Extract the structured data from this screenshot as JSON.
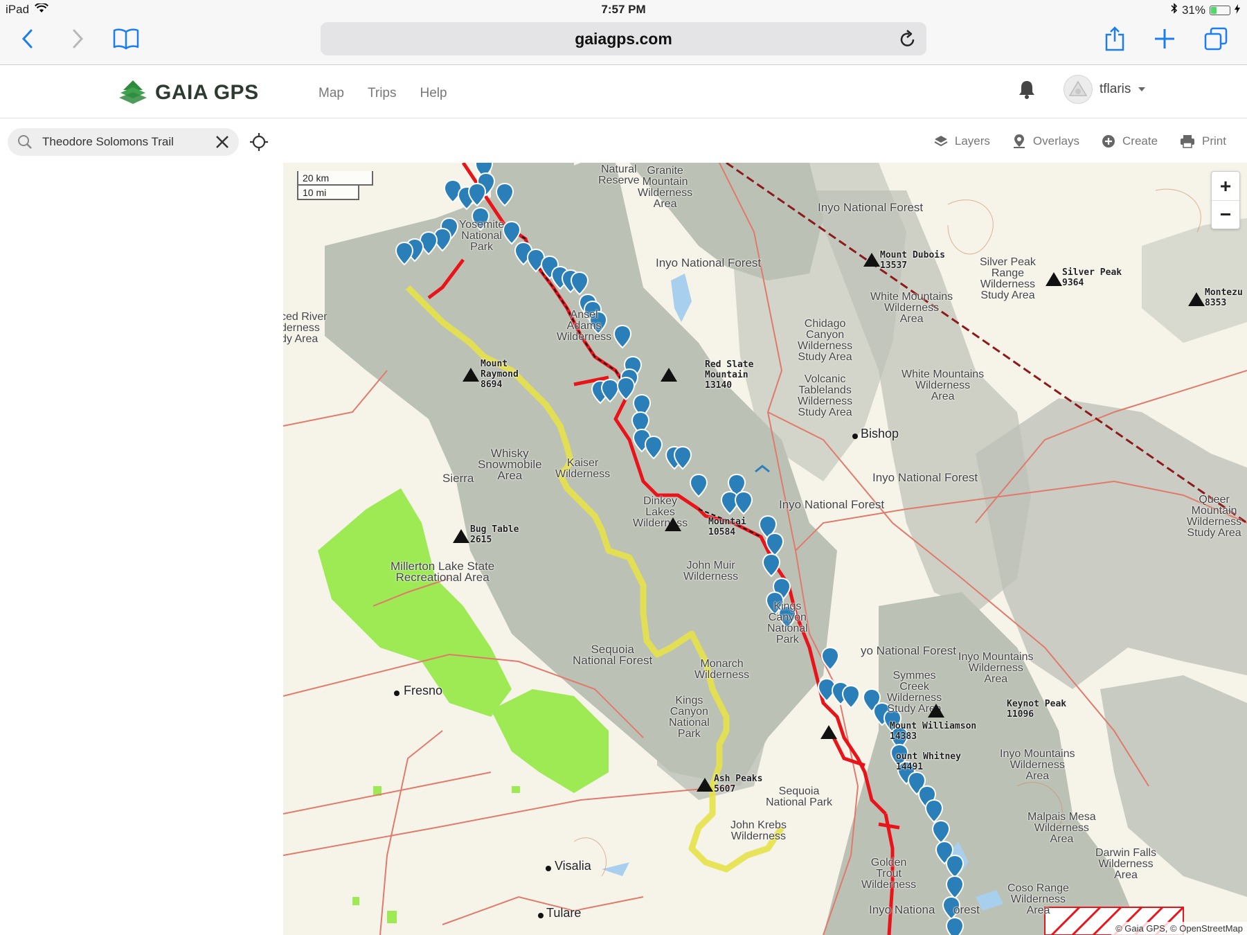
{
  "status_bar": {
    "device": "iPad",
    "time": "7:57 PM",
    "battery": "31%",
    "battery_level": 0.31
  },
  "browser": {
    "url": "gaiagps.com"
  },
  "header": {
    "brand": "GAIA GPS",
    "nav": [
      "Map",
      "Trips",
      "Help"
    ],
    "username": "tflaris"
  },
  "search": {
    "value": "Theodore Solomons Trail"
  },
  "toolbar": {
    "layers": "Layers",
    "overlays": "Overlays",
    "create": "Create",
    "print": "Print"
  },
  "map": {
    "scale": {
      "km": "20 km",
      "mi": "10 mi"
    },
    "zoom_in": "+",
    "zoom_out": "−",
    "attribution": "© Gaia GPS, © OpenStreetMap",
    "colors": {
      "route": "#e8141a",
      "trail": "#e6e24a",
      "waypoint": "#2a7fb8",
      "park": "#9dea54",
      "forest": "#b9beb4"
    },
    "labels": {
      "natural_reserve": "Natural\nReserve",
      "granite_mountain": "Granite\nMountain\nWilderness\nArea",
      "inyo_nf_1": "Inyo National Forest",
      "inyo_nf_2": "Inyo National Forest",
      "inyo_nf_3": "Inyo National Forest",
      "inyo_nf_4": "Inyo National Forest",
      "inyo_nf_5": "yo National Forest",
      "inyo_nf_6": "Inyo Nationa",
      "inyo_nf_7": "orest",
      "yosemite": "Yosemite\nNational\nPark",
      "ansel_adams": "Ansel\nAdams\nWilderness",
      "ced_river": "ced River\nderness\ndy Area",
      "chidago": "Chidago\nCanyon\nWilderness\nStudy Area",
      "volcanic": "Volcanic\nTablelands\nWilderness\nStudy Area",
      "white_mtn_1": "White Mountains\nWilderness\nArea",
      "white_mtn_2": "White Mountains\nWilderness\nArea",
      "silver_peak_range": "Silver Peak\nRange\nWilderness\nStudy Area",
      "whisky": "Whisky\nSnowmobile\nArea",
      "sierra": "Sierra",
      "kaiser": "Kaiser\nWilderness",
      "dinkey": "Dinkey\nLakes\nWilderness",
      "john_muir": "John Muir\nWilderness",
      "millerton": "Millerton Lake State\nRecreational Area",
      "kings_canyon_1": "Kings\nCanyon\nNational\nPark",
      "kings_canyon_2": "Kings\nCanyon\nNational\nPark",
      "sequoia_nf": "Sequoia\nNational Forest",
      "monarch": "Monarch\nWilderness",
      "symmes": "Symmes\nCreek\nWilderness\nStudy Area",
      "inyo_mtn_1": "Inyo Mountains\nWilderness\nArea",
      "inyo_mtn_2": "Inyo Mountains\nWilderness\nArea",
      "sequoia_np": "Sequoia\nNational Park",
      "john_krebs": "John Krebs\nWilderness",
      "golden_trout": "Golden\nTrout\nWilderness",
      "malpais": "Malpais Mesa\nWilderness\nArea",
      "darwin": "Darwin Falls\nWilderness\nArea",
      "coso": "Coso Range\nWilderness\nArea",
      "queer": "Queer\nMountain\nWilderness\nStudy Area"
    },
    "cities": {
      "bishop": "Bishop",
      "fresno": "Fresno",
      "visalia": "Visalia",
      "tulare": "Tulare"
    },
    "peaks": {
      "dubois": "Mount Dubois\n13537",
      "silver_peak": "Silver Peak\n9364",
      "montezuma": "Montezu\n8353",
      "raymond": "Mount\nRaymond\n8694",
      "red_slate": "Red Slate\nMountain\n13140",
      "bug_table": "Bug Table\n2615",
      "mountain_10584": "Mountai\n10584",
      "williamson": "Mount Williamson\n14383",
      "whitney": "ount Whitney\n14491",
      "keynot": "Keynot Peak\n11096",
      "ash": "Ash Peaks\n5607"
    }
  }
}
